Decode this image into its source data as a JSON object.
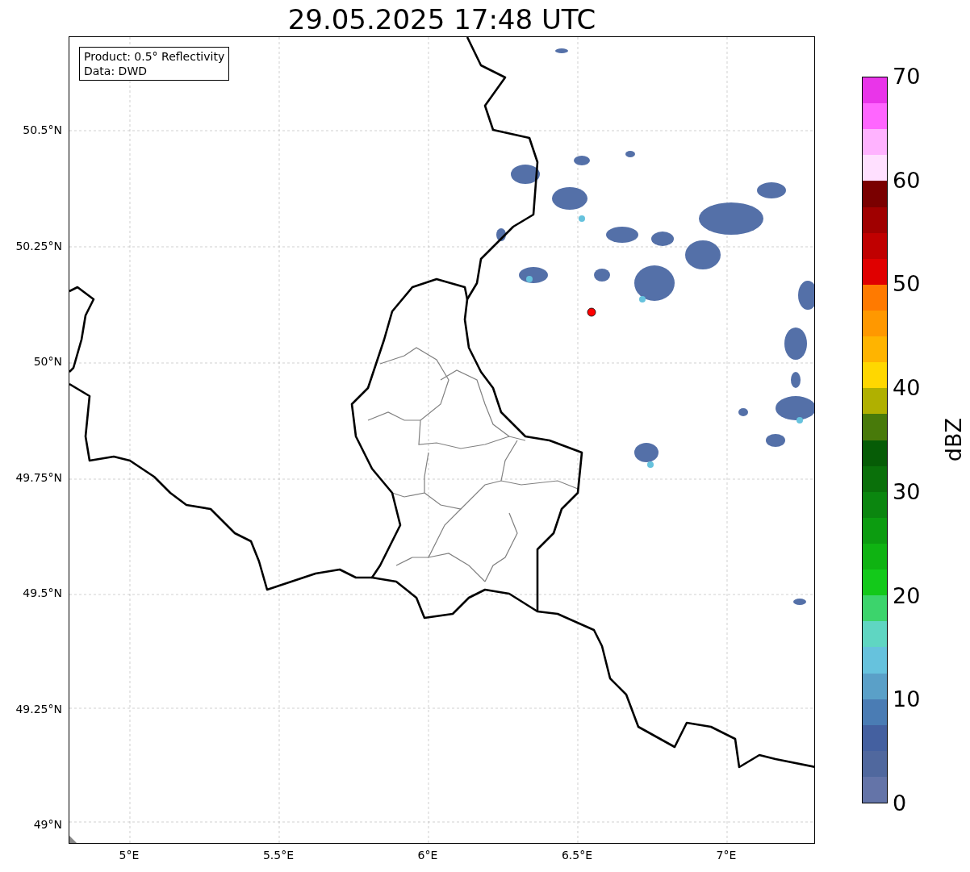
{
  "title": "29.05.2025 17:48 UTC",
  "info_box": [
    "Product: 0.5° Reflectivity",
    "Data: DWD"
  ],
  "y_ticks": [
    "50.5°N",
    "50.25°N",
    "50°N",
    "49.75°N",
    "49.5°N",
    "49.25°N",
    "49°N"
  ],
  "x_ticks": [
    "5°E",
    "5.5°E",
    "6°E",
    "6.5°E",
    "7°E"
  ],
  "colorbar": {
    "label": "dBZ",
    "ticks": [
      "70",
      "60",
      "50",
      "40",
      "30",
      "20",
      "10",
      "0"
    ],
    "bins": [
      {
        "color": "#e935e9"
      },
      {
        "color": "#ff66ff"
      },
      {
        "color": "#ffb3ff"
      },
      {
        "color": "#ffe0ff"
      },
      {
        "color": "#7a0000"
      },
      {
        "color": "#a00000"
      },
      {
        "color": "#c00000"
      },
      {
        "color": "#e00000"
      },
      {
        "color": "#ff7a00"
      },
      {
        "color": "#ff9800"
      },
      {
        "color": "#ffb400"
      },
      {
        "color": "#ffd700"
      },
      {
        "color": "#b0b000"
      },
      {
        "color": "#487a0a"
      },
      {
        "color": "#065c06"
      },
      {
        "color": "#0a700a"
      },
      {
        "color": "#0b860f"
      },
      {
        "color": "#0c9c10"
      },
      {
        "color": "#0fb312"
      },
      {
        "color": "#13c91a"
      },
      {
        "color": "#3cd46c"
      },
      {
        "color": "#5fd6c2"
      },
      {
        "color": "#66c2dd"
      },
      {
        "color": "#5aa0c8"
      },
      {
        "color": "#4a7cb4"
      },
      {
        "color": "#4460a0"
      },
      {
        "color": "#50689e"
      },
      {
        "color": "#6474a8"
      }
    ]
  }
}
